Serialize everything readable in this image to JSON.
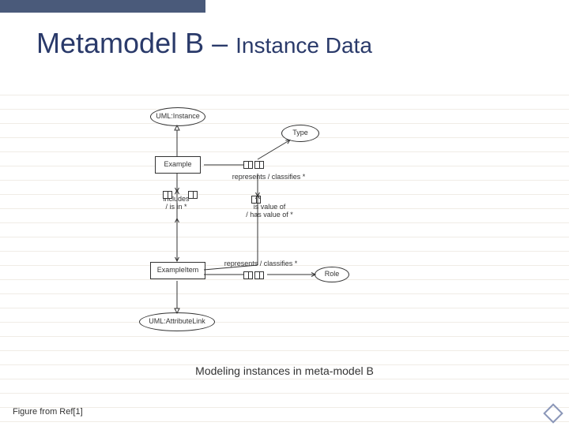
{
  "title": {
    "main": "Metamodel B – ",
    "sub": "Instance Data"
  },
  "diagram": {
    "nodes": {
      "uml_instance": "UML:Instance",
      "type": "Type",
      "example": "Example",
      "includes": "includes\n/ is in *",
      "is_value": "is value of\n/ has value of *",
      "represents1": "represents / classifies *",
      "example_item": "ExampleItem",
      "represents2": "represents / classifies *",
      "role": "Role",
      "uml_attr": "UML:AttributeLink"
    }
  },
  "caption": "Modeling instances in meta-model B",
  "footnote": "Figure from Ref[1]"
}
